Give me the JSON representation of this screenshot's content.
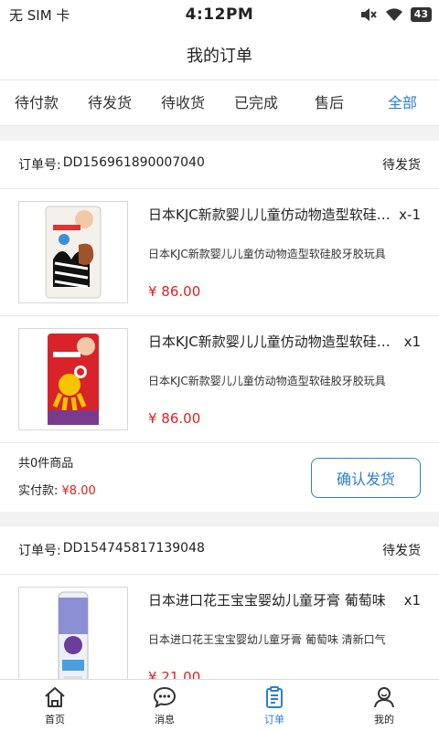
{
  "status_bar": {
    "carrier": "无 SIM 卡",
    "time": "4:12PM",
    "battery": "43"
  },
  "header": {
    "title": "我的订单"
  },
  "tabs": [
    {
      "label": "待付款",
      "active": false
    },
    {
      "label": "待发货",
      "active": false
    },
    {
      "label": "待收货",
      "active": false
    },
    {
      "label": "已完成",
      "active": false
    },
    {
      "label": "售后",
      "active": false
    },
    {
      "label": "全部",
      "active": true
    }
  ],
  "orders": [
    {
      "no_label": "订单号:",
      "no": "DD156961890007040",
      "status": "待发货",
      "items": [
        {
          "title": "日本KJC新款婴儿儿童仿动物造型软硅胶牙胶",
          "qty": "x-1",
          "desc": "日本KJC新款婴儿儿童仿动物造型软硅胶牙胶玩具",
          "price": "¥ 86.00"
        },
        {
          "title": "日本KJC新款婴儿儿童仿动物造型软硅胶牙胶",
          "qty": "x1",
          "desc": "日本KJC新款婴儿儿童仿动物造型软硅胶牙胶玩具",
          "price": "¥ 86.00"
        }
      ],
      "count_text": "共0件商品",
      "paid_label": "实付款:",
      "paid_amount": "¥8.00",
      "action": "确认发货"
    },
    {
      "no_label": "订单号:",
      "no": "DD154745817139048",
      "status": "待发货",
      "items": [
        {
          "title": "日本进口花王宝宝婴幼儿童牙膏 葡萄味",
          "qty": "x1",
          "desc": "日本进口花王宝宝婴幼儿童牙膏 葡萄味 清新口气",
          "price": "¥ 21.00"
        }
      ]
    }
  ],
  "bottom_nav": [
    {
      "label": "首页",
      "icon": "home-icon",
      "active": false
    },
    {
      "label": "消息",
      "icon": "message-icon",
      "active": false
    },
    {
      "label": "订单",
      "icon": "order-icon",
      "active": true
    },
    {
      "label": "我的",
      "icon": "user-icon",
      "active": false
    }
  ],
  "colors": {
    "accent": "#2a7fd4",
    "price": "#e02020"
  }
}
